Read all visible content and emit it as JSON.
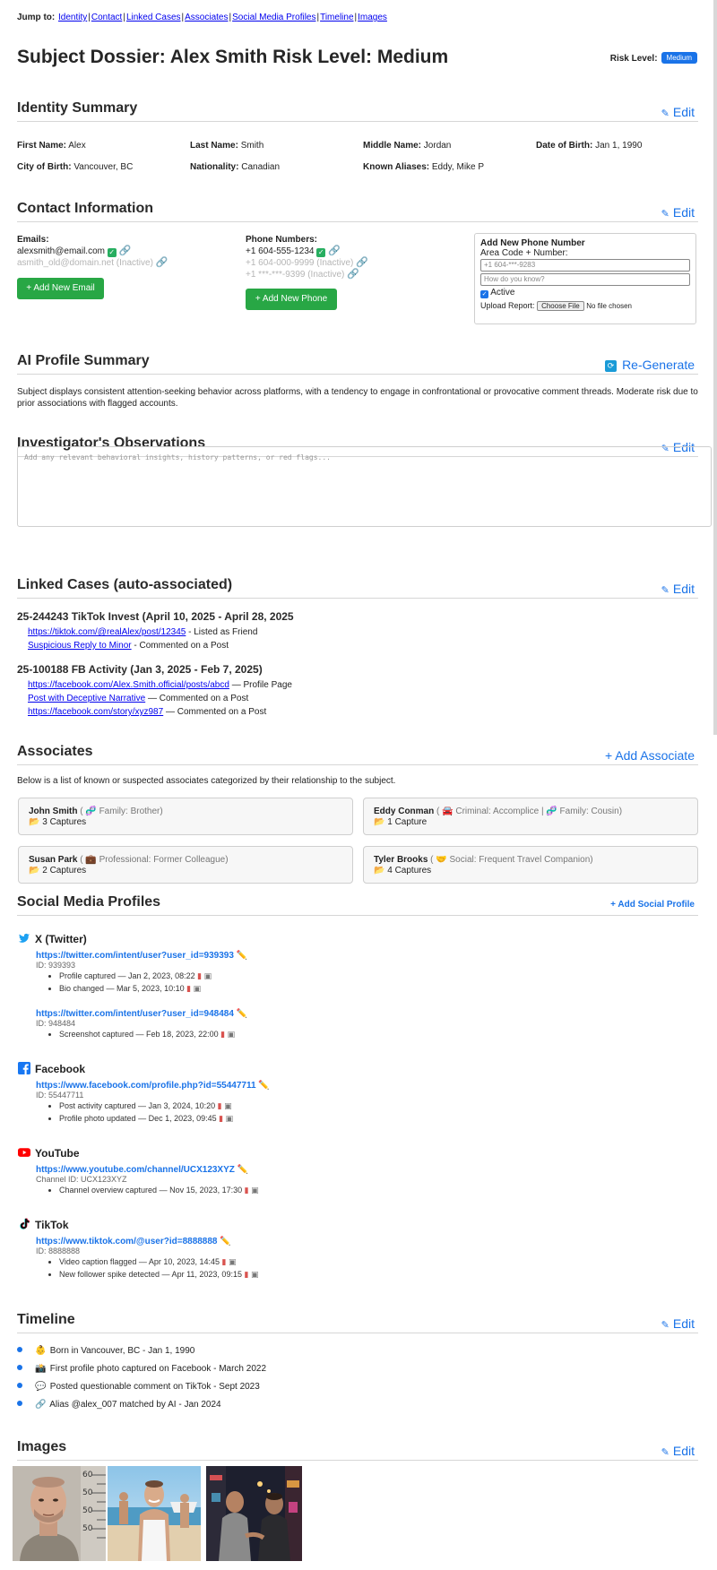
{
  "jump": {
    "label": "Jump to:",
    "links": [
      "Identity",
      "Contact",
      "Linked Cases",
      "Associates",
      "Social Media Profiles",
      "Timeline",
      "Images"
    ]
  },
  "header": {
    "title": "Subject Dossier: Alex Smith Risk Level: Medium",
    "risk_label": "Risk Level:",
    "risk_value": "Medium",
    "accent_color": "#1a73e8"
  },
  "identity": {
    "title": "Identity Summary",
    "edit_label": "Edit",
    "fields": [
      {
        "label": "First Name:",
        "value": "Alex"
      },
      {
        "label": "Last Name:",
        "value": "Smith"
      },
      {
        "label": "Middle Name:",
        "value": "Jordan"
      },
      {
        "label": "Date of Birth:",
        "value": "Jan 1, 1990"
      },
      {
        "label": "City of Birth:",
        "value": "Vancouver, BC"
      },
      {
        "label": "Nationality:",
        "value": "Canadian"
      },
      {
        "label": "Known Aliases:",
        "value": "Eddy, Mike P"
      }
    ]
  },
  "contact": {
    "title": "Contact Information",
    "edit_label": "Edit",
    "emails_label": "Emails:",
    "emails": [
      {
        "address": "alexsmith@email.com",
        "status": ""
      },
      {
        "address": "asmith_old@domain.net",
        "status": "(Inactive)"
      }
    ],
    "add_email_label": "+ Add New Email",
    "phones_label": "Phone Numbers:",
    "phones": [
      {
        "number": "+1 604-555-1234",
        "status": ""
      },
      {
        "number": "+1 604-000-9999",
        "status": "(Inactive)"
      },
      {
        "number": "+1 ***-***-9399",
        "status": "(Inactive)"
      }
    ],
    "add_phone_label": "+ Add New Phone",
    "panel": {
      "title": "Add New Phone Number",
      "area_label": "Area Code + Number:",
      "area_placeholder": "+1 604-***-9283",
      "how_placeholder": "How do you know?",
      "active_label": "Active",
      "active_checked": true,
      "upload_label": "Upload Report:",
      "choose_file_label": "Choose File",
      "no_file_label": "No file chosen"
    }
  },
  "ai": {
    "title": "AI Profile Summary",
    "regen_label": "Re-Generate",
    "text": "Subject displays consistent attention-seeking behavior across platforms, with a tendency to engage in confrontational or provocative comment threads. Moderate risk due to prior associations with flagged accounts."
  },
  "observations": {
    "title": "Investigator's Observations",
    "edit_label": "Edit",
    "placeholder": "Add any relevant behavioral insights, history patterns, or red flags..."
  },
  "cases": {
    "title": "Linked Cases (auto-associated)",
    "edit_label": "Edit",
    "items": [
      {
        "title": "25-244243 TikTok Invest (April 10, 2025 - April 28, 2025",
        "links": [
          {
            "text": "https://tiktok.com/@realAlex/post/12345",
            "note": "- Listed as Friend"
          },
          {
            "text": "Suspicious Reply to Minor",
            "note": "- Commented on a Post"
          }
        ]
      },
      {
        "title": "25-100188 FB Activity (Jan 3, 2025 - Feb 7, 2025)",
        "links": [
          {
            "text": "https://facebook.com/Alex.Smith.official/posts/abcd",
            "note": "— Profile Page"
          },
          {
            "text": "Post with Deceptive Narrative",
            "note": "— Commented on a Post"
          },
          {
            "text": "https://facebook.com/story/xyz987",
            "note": "— Commented on a Post"
          }
        ]
      }
    ]
  },
  "associates": {
    "title": "Associates",
    "add_label": "+ Add Associate",
    "intro": "Below is a list of known or suspected associates categorized by their relationship to the subject.",
    "people": [
      {
        "name": "John Smith",
        "relation": "Family: Brother",
        "captures": "3 Captures"
      },
      {
        "name": "Eddy Conman",
        "relation": "Criminal: Accomplice | 🧬 Family: Cousin",
        "captures": "1 Capture"
      },
      {
        "name": "Susan Park",
        "relation": "Professional: Former Colleague",
        "captures": "2 Captures"
      },
      {
        "name": "Tyler Brooks",
        "relation": "Social: Frequent Travel Companion",
        "captures": "4 Captures"
      }
    ]
  },
  "social": {
    "title": "Social Media Profiles",
    "add_label": "+ Add Social Profile",
    "platforms": [
      {
        "name": "X (Twitter)",
        "color": "#1da1f2",
        "accounts": [
          {
            "url": "https://twitter.com/intent/user?user_id=939393",
            "id": "ID: 939393",
            "events": [
              "Profile captured — Jan 2, 2023, 08:22",
              "Bio changed — Mar 5, 2023, 10:10"
            ]
          },
          {
            "url": "https://twitter.com/intent/user?user_id=948484",
            "id": "ID: 948484",
            "events": [
              "Screenshot captured — Feb 18, 2023, 22:00"
            ]
          }
        ]
      },
      {
        "name": "Facebook",
        "color": "#1877f2",
        "accounts": [
          {
            "url": "https://www.facebook.com/profile.php?id=55447711",
            "id": "ID: 55447711",
            "events": [
              "Post activity captured — Jan 3, 2024, 10:20",
              "Profile photo updated — Dec 1, 2023, 09:45"
            ]
          }
        ]
      },
      {
        "name": "YouTube",
        "color": "#ff0000",
        "accounts": [
          {
            "url": "https://www.youtube.com/channel/UCX123XYZ",
            "id": "Channel ID: UCX123XYZ",
            "events": [
              "Channel overview captured — Nov 15, 2023, 17:30"
            ]
          }
        ]
      },
      {
        "name": "TikTok",
        "color": "#111111",
        "accounts": [
          {
            "url": "https://www.tiktok.com/@user?id=8888888",
            "id": "ID: 8888888",
            "events": [
              "Video caption flagged — Apr 10, 2023, 14:45",
              "New follower spike detected — Apr 11, 2023, 09:15"
            ]
          }
        ]
      }
    ]
  },
  "timeline": {
    "title": "Timeline",
    "edit_label": "Edit",
    "events": [
      {
        "icon": "👶",
        "text": "Born in Vancouver, BC - Jan 1, 1990"
      },
      {
        "icon": "📸",
        "text": "First profile photo captured on Facebook - March 2022"
      },
      {
        "icon": "💬",
        "text": "Posted questionable comment on TikTok - Sept 2023"
      },
      {
        "icon": "🔗",
        "text": "Alias @alex_007 matched by AI - Jan 2024"
      }
    ]
  },
  "images": {
    "title": "Images",
    "edit_label": "Edit",
    "height_chart_labels": [
      "60",
      "50",
      "50",
      "50"
    ]
  }
}
